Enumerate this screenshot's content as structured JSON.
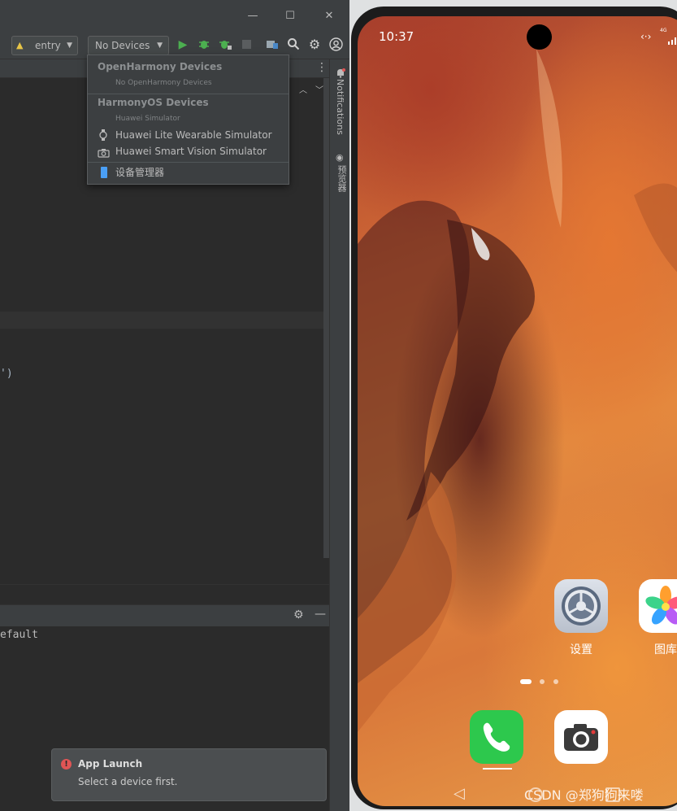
{
  "toolbar": {
    "module_label": "entry",
    "device_label": "No Devices"
  },
  "device_dropdown": {
    "openharmony_header": "OpenHarmony Devices",
    "openharmony_empty": "No OpenHarmony Devices",
    "harmonyos_header": "HarmonyOS Devices",
    "harmonyos_sub": "Huawei Simulator",
    "items": [
      {
        "label": "Huawei Lite Wearable Simulator",
        "icon": "watch-icon"
      },
      {
        "label": "Huawei Smart Vision Simulator",
        "icon": "camera-icon"
      }
    ],
    "device_manager_label": "设备管理器"
  },
  "side_panel": {
    "notifications_label": "Notifications",
    "previewer_label": "预览器"
  },
  "editor": {
    "visible_fragment": "')"
  },
  "tool_window": {
    "output_fragment": "efault"
  },
  "notification": {
    "title": "App Launch",
    "message": "Select a device first."
  },
  "phone": {
    "time": "10:37",
    "network_label": "4G",
    "apps": [
      {
        "label": "设置",
        "icon": "settings-icon"
      },
      {
        "label": "图库",
        "icon": "gallery-icon"
      }
    ],
    "dock": [
      {
        "icon": "phone-icon"
      },
      {
        "icon": "camera-icon"
      }
    ]
  },
  "watermark": "CSDN @郑狗狗来喽",
  "colors": {
    "run_green": "#4caf50",
    "error_red": "#e05555",
    "dock_green": "#2dc84d"
  }
}
